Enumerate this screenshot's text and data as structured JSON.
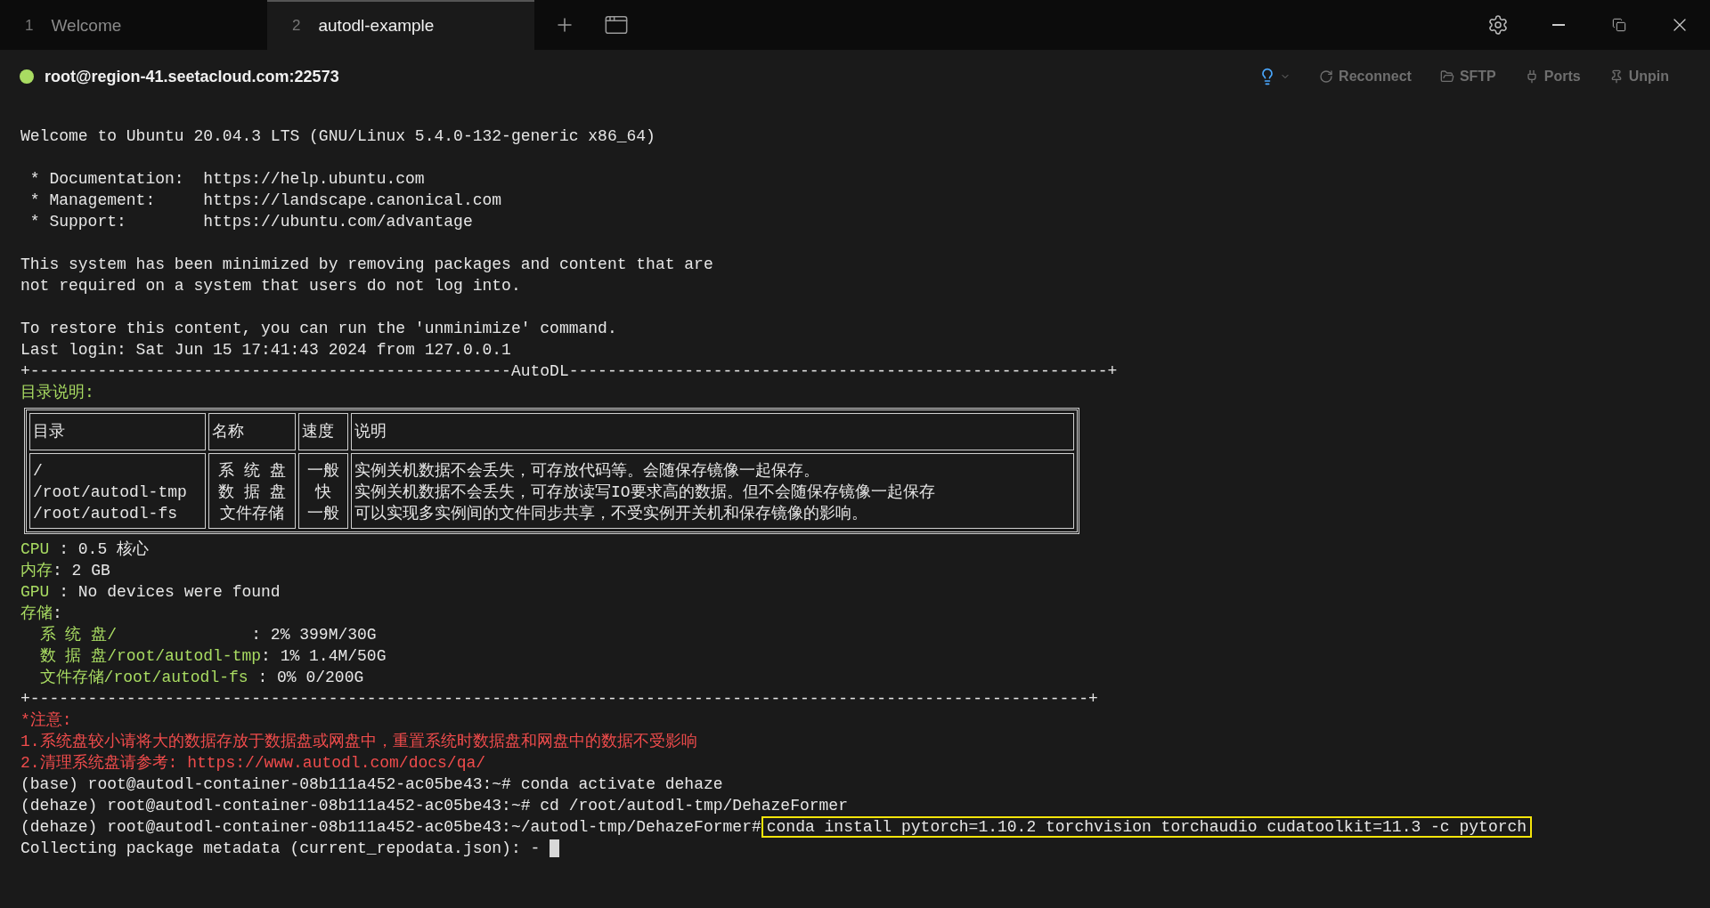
{
  "tabs": [
    {
      "number": "1",
      "label": "Welcome",
      "selected": false
    },
    {
      "number": "2",
      "label": "autodl-example",
      "selected": true
    }
  ],
  "session": {
    "host": "root@region-41.seetacloud.com:22573",
    "connected": true,
    "actions": [
      {
        "kind": "tip"
      },
      {
        "kind": "reconnect",
        "label": "Reconnect"
      },
      {
        "kind": "sftp",
        "label": "SFTP"
      },
      {
        "kind": "ports",
        "label": "Ports"
      },
      {
        "kind": "unpin",
        "label": "Unpin"
      }
    ]
  },
  "terminal": {
    "lines": [
      {
        "kind": "plain",
        "text": "Welcome to Ubuntu 20.04.3 LTS (GNU/Linux 5.4.0-132-generic x86_64)"
      },
      {
        "kind": "blank"
      },
      {
        "kind": "plain",
        "text": " * Documentation:  https://help.ubuntu.com"
      },
      {
        "kind": "plain",
        "text": " * Management:     https://landscape.canonical.com"
      },
      {
        "kind": "plain",
        "text": " * Support:        https://ubuntu.com/advantage"
      },
      {
        "kind": "blank"
      },
      {
        "kind": "plain",
        "text": "This system has been minimized by removing packages and content that are"
      },
      {
        "kind": "plain",
        "text": "not required on a system that users do not log into."
      },
      {
        "kind": "blank"
      },
      {
        "kind": "plain",
        "text": "To restore this content, you can run the 'unminimize' command."
      },
      {
        "kind": "plain",
        "text": "Last login: Sat Jun 15 17:41:43 2024 from 127.0.0.1"
      },
      {
        "kind": "plain",
        "text": "+--------------------------------------------------AutoDL--------------------------------------------------------+"
      },
      {
        "kind": "heading",
        "text": "目录说明:"
      },
      {
        "kind": "table",
        "columns": [
          "目录",
          "名称",
          "速度",
          "说明"
        ],
        "rows": [
          {
            "cells": [
              [
                "/",
                "/root/autodl-tmp",
                "/root/autodl-fs"
              ],
              [
                "系 统 盘",
                "数 据 盘",
                "文件存储"
              ],
              [
                "一般",
                "快",
                "一般"
              ],
              [
                "实例关机数据不会丢失，可存放代码等。会随保存镜像一起保存。",
                "实例关机数据不会丢失，可存放读写IO要求高的数据。但不会随保存镜像一起保存",
                "可以实现多实例间的文件同步共享，不受实例开关机和保存镜像的影响。"
              ]
            ]
          }
        ]
      },
      {
        "kind": "stat",
        "label": "CPU ",
        "value": ": 0.5 核心"
      },
      {
        "kind": "stat",
        "label": "内存",
        "value": ": 2 GB"
      },
      {
        "kind": "stat",
        "label": "GPU ",
        "value": ": No devices were found"
      },
      {
        "kind": "stat",
        "label": "存储",
        "value": ":"
      },
      {
        "kind": "stat",
        "label": "  系 统 盘/              ",
        "value": ": 2% 399M/30G"
      },
      {
        "kind": "stat",
        "label": "  数 据 盘/root/autodl-tmp",
        "value": ": 1% 1.4M/50G"
      },
      {
        "kind": "stat",
        "label": "  文件存储/root/autodl-fs ",
        "value": ": 0% 0/200G"
      },
      {
        "kind": "plain",
        "text": "+--------------------------------------------------------------------------------------------------------------+"
      },
      {
        "kind": "warning",
        "text": "*注意:"
      },
      {
        "kind": "warning",
        "text": "1.系统盘较小请将大的数据存放于数据盘或网盘中，重置系统时数据盘和网盘中的数据不受影响"
      },
      {
        "kind": "warning",
        "text": "2.清理系统盘请参考: https://www.autodl.com/docs/qa/"
      },
      {
        "kind": "prompt",
        "prompt": "(base) root@autodl-container-08b111a452-ac05be43:~# ",
        "command": "conda activate dehaze",
        "highlighted": false
      },
      {
        "kind": "prompt",
        "prompt": "(dehaze) root@autodl-container-08b111a452-ac05be43:~# ",
        "command": "cd /root/autodl-tmp/DehazeFormer",
        "highlighted": false
      },
      {
        "kind": "prompt",
        "prompt": "(dehaze) root@autodl-container-08b111a452-ac05be43:~/autodl-tmp/DehazeFormer#",
        "command": "conda install pytorch=1.10.2 torchvision torchaudio cudatoolkit=11.3 -c pytorch",
        "highlighted": true
      },
      {
        "kind": "output",
        "text": "Collecting package metadata (current_repodata.json): - ",
        "cursor": true
      }
    ]
  }
}
